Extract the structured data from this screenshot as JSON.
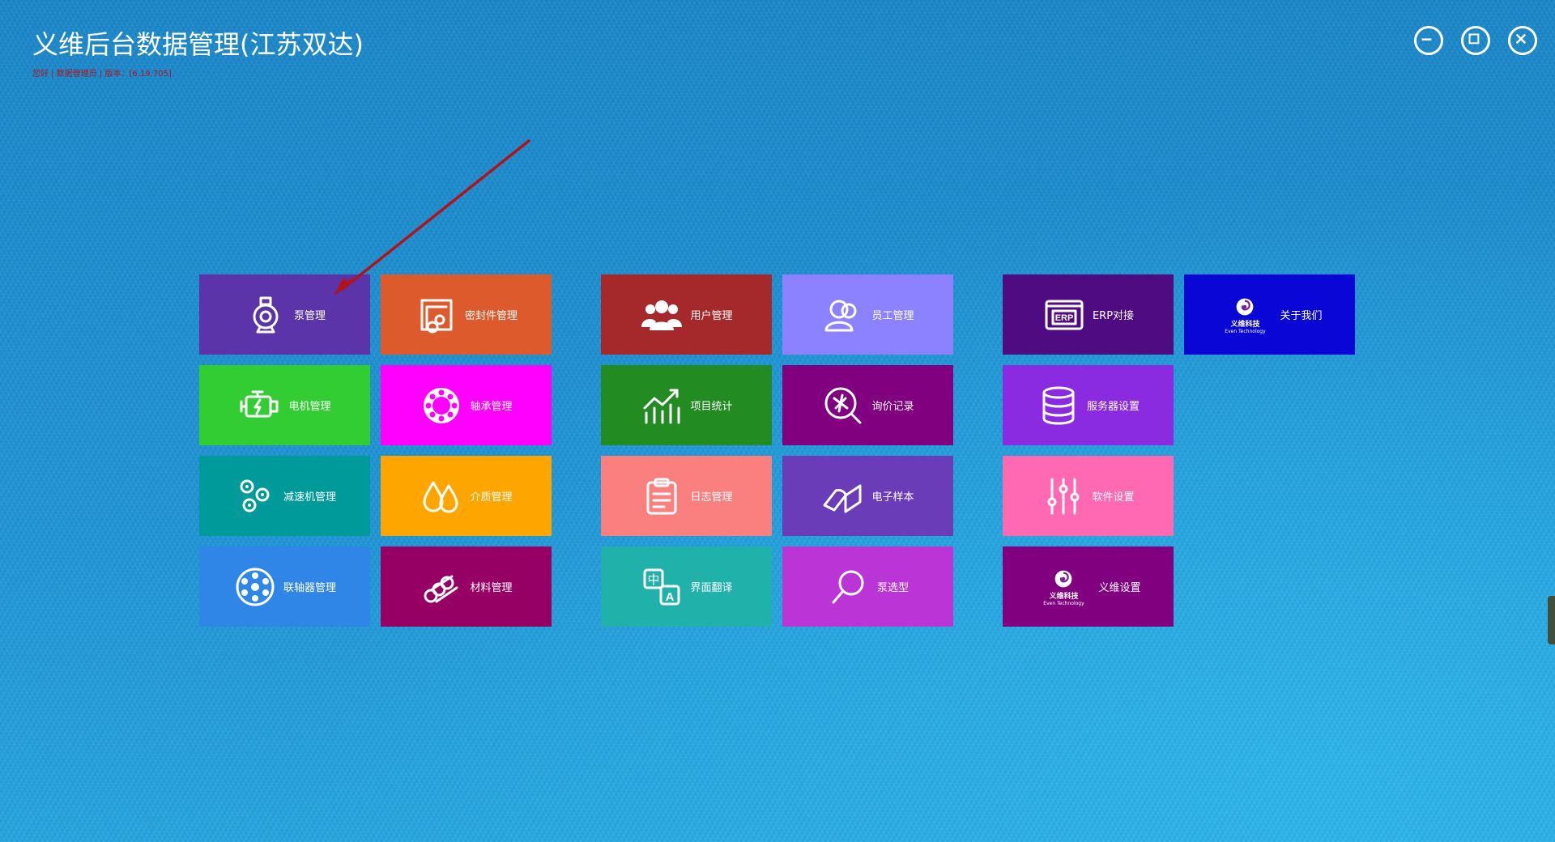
{
  "app": {
    "title": "义维后台数据管理(江苏双达)",
    "subtitle": "您好 | 数据管理员 | 版本：[6.19.705]"
  },
  "window_controls": {
    "minimize_icon": "minus-circle-icon",
    "maximize_icon": "restore-window-icon",
    "close_icon": "close-circle-icon"
  },
  "tiles": [
    {
      "label": "泵管理",
      "color": "#5a34a8",
      "icon": "pump-icon"
    },
    {
      "label": "密封件管理",
      "color": "#dc5a2b",
      "icon": "seal-icon"
    },
    {
      "label": "用户管理",
      "color": "#a5282a",
      "icon": "users-icon"
    },
    {
      "label": "员工管理",
      "color": "#8c82ff",
      "icon": "employee-icon"
    },
    {
      "label": "ERP对接",
      "color": "#4f0c82",
      "icon": "erp-icon"
    },
    {
      "label": "关于我们",
      "color": "#0a06d6",
      "icon": "even-logo-icon"
    },
    {
      "label": "电机管理",
      "color": "#32cd32",
      "icon": "motor-icon"
    },
    {
      "label": "轴承管理",
      "color": "#ff00ff",
      "icon": "bearing-icon"
    },
    {
      "label": "项目统计",
      "color": "#228b22",
      "icon": "chart-icon"
    },
    {
      "label": "询价记录",
      "color": "#800080",
      "icon": "inquiry-icon"
    },
    {
      "label": "服务器设置",
      "color": "#8a2be2",
      "icon": "database-icon"
    },
    {
      "label": "减速机管理",
      "color": "#009a9a",
      "icon": "gears-icon"
    },
    {
      "label": "介质管理",
      "color": "#ffa500",
      "icon": "drops-icon"
    },
    {
      "label": "日志管理",
      "color": "#fa8080",
      "icon": "clipboard-icon"
    },
    {
      "label": "电子样本",
      "color": "#6a3cb8",
      "icon": "book-icon"
    },
    {
      "label": "软件设置",
      "color": "#ff69b4",
      "icon": "sliders-icon"
    },
    {
      "label": "联轴器管理",
      "color": "#2f86e6",
      "icon": "coupling-icon"
    },
    {
      "label": "材料管理",
      "color": "#960064",
      "icon": "material-icon"
    },
    {
      "label": "界面翻译",
      "color": "#20b2aa",
      "icon": "translate-icon"
    },
    {
      "label": "泵选型",
      "color": "#ba34d6",
      "icon": "search-icon"
    },
    {
      "label": "义维设置",
      "color": "#800080",
      "icon": "even-logo-icon"
    }
  ],
  "logo_text": {
    "cn": "义维科技",
    "en": "Even Technology"
  },
  "annotation": {
    "arrow_color": "#b01418"
  }
}
